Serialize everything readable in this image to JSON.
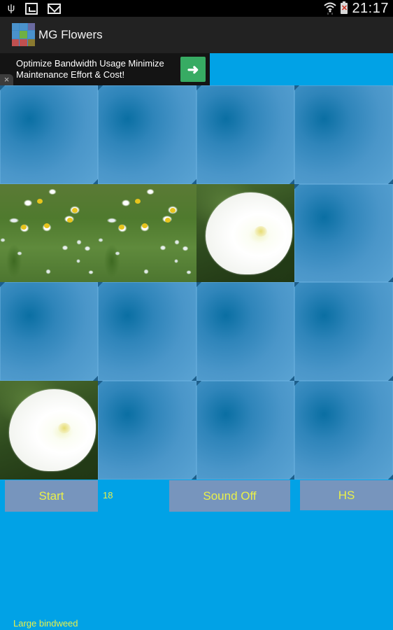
{
  "status_bar": {
    "left_icons": [
      "usb-icon",
      "gallery-icon",
      "gmail-icon"
    ],
    "right_icons": [
      "wifi-icon",
      "battery-alert-icon"
    ],
    "time": "21:17"
  },
  "action_bar": {
    "app_icon": "app-icon",
    "title": "MG Flowers"
  },
  "ad": {
    "text": "Optimize Bandwidth Usage Minimize Maintenance Effort & Cost!",
    "arrow_icon": "arrow-right-icon",
    "arrow_glyph": "➜",
    "close_glyph": "×",
    "button_color": "#37ab63"
  },
  "board": {
    "rows": 4,
    "cols": 4,
    "tiles": [
      {
        "state": "hidden"
      },
      {
        "state": "hidden"
      },
      {
        "state": "hidden"
      },
      {
        "state": "hidden"
      },
      {
        "state": "revealed",
        "flower": "Chamomile"
      },
      {
        "state": "revealed",
        "flower": "Chamomile"
      },
      {
        "state": "revealed",
        "flower": "Large bindweed"
      },
      {
        "state": "hidden"
      },
      {
        "state": "hidden"
      },
      {
        "state": "hidden"
      },
      {
        "state": "hidden"
      },
      {
        "state": "hidden"
      },
      {
        "state": "revealed",
        "flower": "Large bindweed"
      },
      {
        "state": "hidden"
      },
      {
        "state": "hidden"
      },
      {
        "state": "hidden"
      }
    ]
  },
  "controls": {
    "start_label": "Start",
    "counter": "18",
    "sound_label": "Sound Off",
    "hs_label": "HS"
  },
  "footer": {
    "flower_name": "Large bindweed"
  },
  "colors": {
    "background": "#01a2e6",
    "button": "#7795bd",
    "button_text": "#e9f04a",
    "action_bar": "#222222"
  }
}
